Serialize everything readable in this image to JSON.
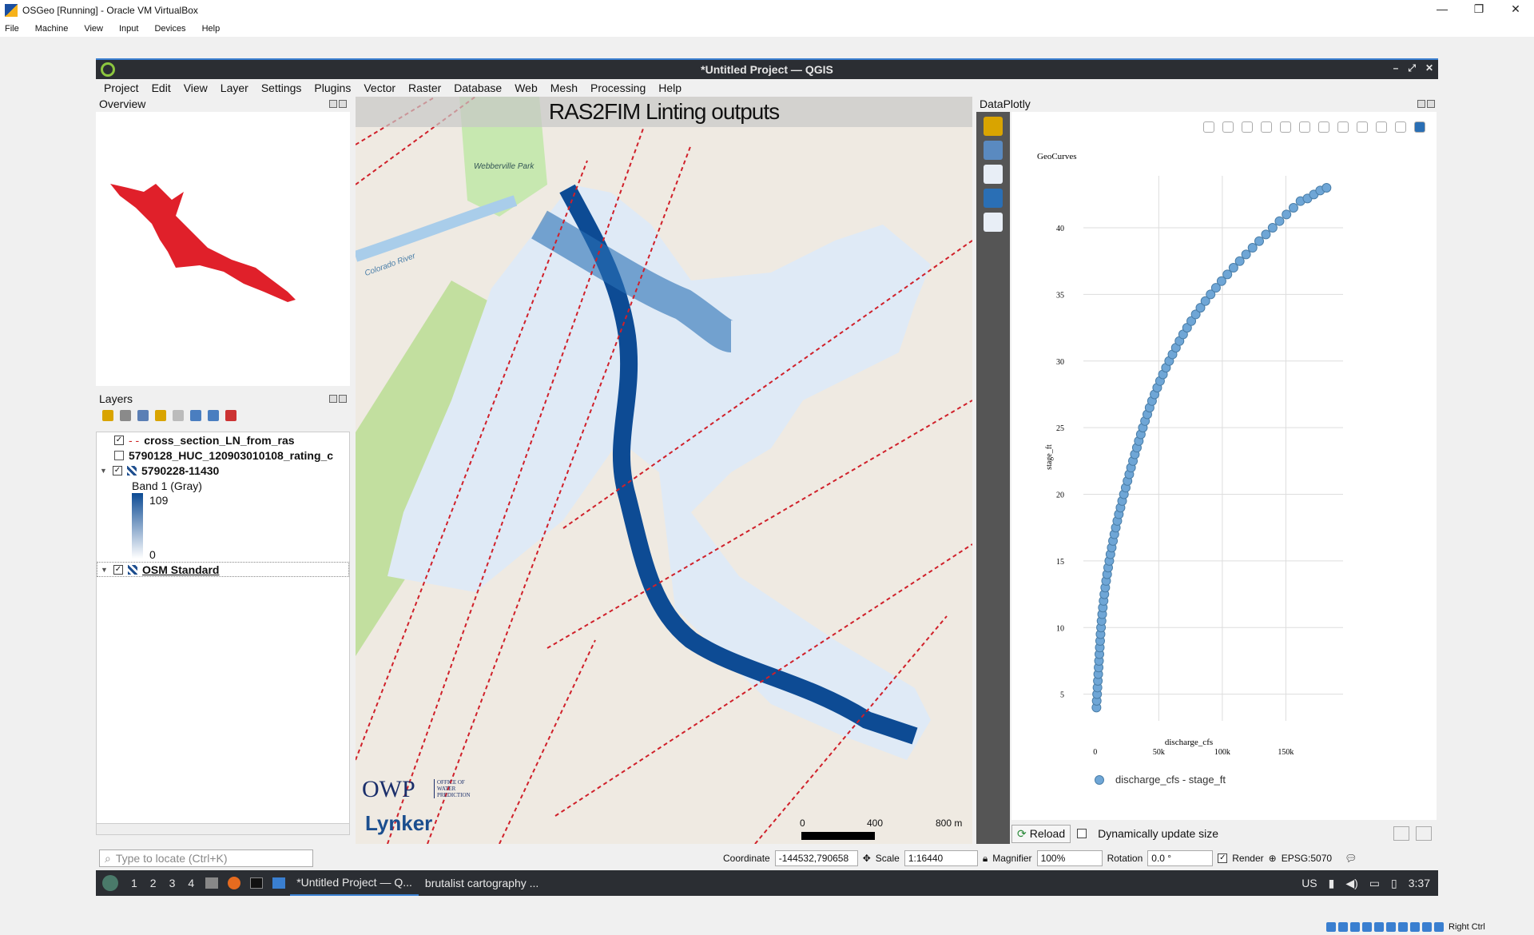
{
  "vbox": {
    "title": "OSGeo [Running] - Oracle VM VirtualBox",
    "menu": [
      "File",
      "Machine",
      "View",
      "Input",
      "Devices",
      "Help"
    ],
    "controls": [
      "—",
      "❐",
      "✕"
    ]
  },
  "qgis": {
    "title": "*Untitled Project — QGIS",
    "window_controls": [
      "–",
      "⤢",
      "✕"
    ],
    "menu": [
      "Project",
      "Edit",
      "View",
      "Layer",
      "Settings",
      "Plugins",
      "Vector",
      "Raster",
      "Database",
      "Web",
      "Mesh",
      "Processing",
      "Help"
    ]
  },
  "overview": {
    "title": "Overview"
  },
  "layers": {
    "title": "Layers",
    "items": [
      {
        "name": "cross_section_LN_from_ras",
        "checked": "✓"
      },
      {
        "name": "5790128_HUC_120903010108_rating_c",
        "checked": ""
      },
      {
        "name": "5790228-11430",
        "checked": "✓"
      },
      {
        "name": "OSM Standard",
        "checked": "✓"
      }
    ],
    "band_label": "Band 1 (Gray)",
    "band_max": "109",
    "band_min": "0"
  },
  "locator": {
    "placeholder": "Type to locate (Ctrl+K)"
  },
  "map": {
    "title": "RAS2FIM Linting outputs",
    "owp": "OWP",
    "owp_small": "OFFICE OF WATER PREDICTION",
    "lynker": "Lynker",
    "place_labels": [
      "Webberville Park",
      "Colorado River"
    ],
    "scale_labels": [
      "0",
      "400",
      "800 m"
    ]
  },
  "dataplotly": {
    "title": "DataPlotly",
    "plot_title": "GeoCurves",
    "reload": "Reload",
    "dyn_label": "Dynamically update size"
  },
  "chart_data": {
    "type": "scatter",
    "title": "GeoCurves",
    "xlabel": "discharge_cfs",
    "ylabel": "stage_ft",
    "xlim": [
      -3000,
      195000
    ],
    "ylim": [
      3,
      43
    ],
    "x_ticks": [
      {
        "v": 0,
        "t": "0"
      },
      {
        "v": 50000,
        "t": "50k"
      },
      {
        "v": 100000,
        "t": "100k"
      },
      {
        "v": 150000,
        "t": "150k"
      }
    ],
    "y_ticks": [
      5,
      10,
      15,
      20,
      25,
      30,
      35,
      40
    ],
    "grid": true,
    "legend": "bottom-left",
    "series": [
      {
        "name": "discharge_cfs - stage_ft",
        "color": "#6fa6d6",
        "points": [
          [
            1000,
            4
          ],
          [
            1200,
            4.5
          ],
          [
            1500,
            5
          ],
          [
            1800,
            5.5
          ],
          [
            2100,
            6
          ],
          [
            2400,
            6.5
          ],
          [
            2700,
            7
          ],
          [
            3000,
            7.5
          ],
          [
            3300,
            8
          ],
          [
            3600,
            8.5
          ],
          [
            3900,
            9
          ],
          [
            4200,
            9.5
          ],
          [
            4600,
            10
          ],
          [
            5000,
            10.5
          ],
          [
            5500,
            11
          ],
          [
            6000,
            11.5
          ],
          [
            6600,
            12
          ],
          [
            7200,
            12.5
          ],
          [
            7900,
            13
          ],
          [
            8600,
            13.5
          ],
          [
            9400,
            14
          ],
          [
            10200,
            14.5
          ],
          [
            11100,
            15
          ],
          [
            12000,
            15.5
          ],
          [
            13000,
            16
          ],
          [
            14000,
            16.5
          ],
          [
            15100,
            17
          ],
          [
            16200,
            17.5
          ],
          [
            17400,
            18
          ],
          [
            18600,
            18.5
          ],
          [
            19900,
            19
          ],
          [
            21200,
            19.5
          ],
          [
            22600,
            20
          ],
          [
            24000,
            20.5
          ],
          [
            25400,
            21
          ],
          [
            26800,
            21.5
          ],
          [
            28200,
            22
          ],
          [
            29700,
            22.5
          ],
          [
            31200,
            23
          ],
          [
            32800,
            23.5
          ],
          [
            34300,
            24
          ],
          [
            35900,
            24.5
          ],
          [
            37500,
            25
          ],
          [
            39200,
            25.5
          ],
          [
            41000,
            26
          ],
          [
            42800,
            26.5
          ],
          [
            44700,
            27
          ],
          [
            46700,
            27.5
          ],
          [
            48800,
            28
          ],
          [
            51000,
            28.5
          ],
          [
            53300,
            29
          ],
          [
            55700,
            29.5
          ],
          [
            58200,
            30
          ],
          [
            60800,
            30.5
          ],
          [
            63500,
            31
          ],
          [
            66300,
            31.5
          ],
          [
            69200,
            32
          ],
          [
            72300,
            32.5
          ],
          [
            75600,
            33
          ],
          [
            79100,
            33.5
          ],
          [
            82800,
            34
          ],
          [
            86700,
            34.5
          ],
          [
            90800,
            35
          ],
          [
            95000,
            35.5
          ],
          [
            99400,
            36
          ],
          [
            104000,
            36.5
          ],
          [
            108800,
            37
          ],
          [
            113700,
            37.5
          ],
          [
            118700,
            38
          ],
          [
            123800,
            38.5
          ],
          [
            129000,
            39
          ],
          [
            134300,
            39.5
          ],
          [
            139600,
            40
          ],
          [
            145000,
            40.5
          ],
          [
            150500,
            41
          ],
          [
            156000,
            41.5
          ],
          [
            161500,
            42
          ],
          [
            167000,
            42.2
          ],
          [
            172000,
            42.5
          ],
          [
            177000,
            42.8
          ],
          [
            182000,
            43
          ]
        ]
      }
    ]
  },
  "status": {
    "coordinate_label": "Coordinate",
    "coordinate": "-144532,790658",
    "scale_label": "Scale",
    "scale": "1:16440",
    "magnifier_label": "Magnifier",
    "magnifier": "100%",
    "rotation_label": "Rotation",
    "rotation": "0.0 °",
    "render_label": "Render",
    "epsg": "EPSG:5070"
  },
  "taskbar": {
    "workspaces": [
      "1",
      "2",
      "3",
      "4"
    ],
    "tasks": [
      "*Untitled Project — Q...",
      "brutalist cartography ..."
    ],
    "lang": "US",
    "time": "3:37"
  },
  "tray": {
    "right_ctrl": "Right Ctrl"
  }
}
